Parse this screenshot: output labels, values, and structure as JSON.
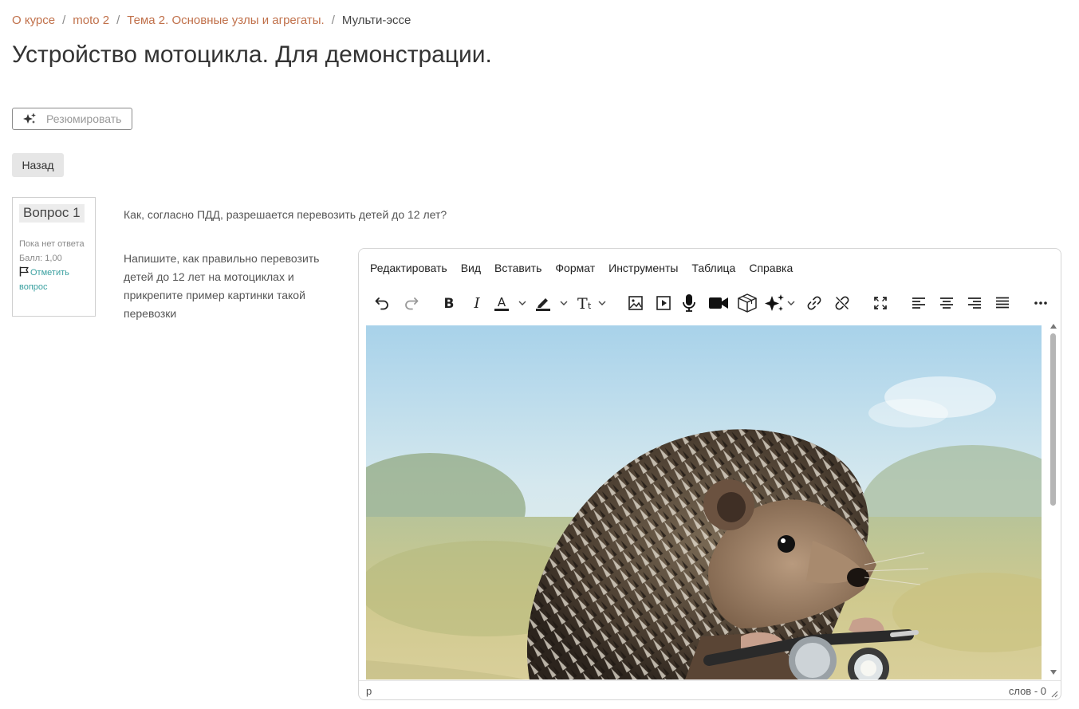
{
  "breadcrumb": {
    "items": [
      "О курсе",
      "moto 2",
      "Тема 2. Основные узлы и агрегаты."
    ],
    "current": "Мульти-эссе",
    "separator": "/"
  },
  "page_title": "Устройство мотоцикла. Для демонстрации.",
  "summarize_button": {
    "label": "Резюмировать",
    "icon": "sparkles-icon"
  },
  "back_button": {
    "label": "Назад"
  },
  "question_info": {
    "title": "Вопрос 1",
    "status": "Пока нет ответа",
    "score": "Балл: 1,00",
    "flag_label": "Отметить вопрос"
  },
  "question_text": "Как, согласно ПДД, разрешается перевозить детей до 12 лет?",
  "prompt_text": "Напишите, как правильно перевозить детей до 12 лет на мотоциклах и прикрепите пример картинки такой перевозки",
  "editor": {
    "menus": [
      "Редактировать",
      "Вид",
      "Вставить",
      "Формат",
      "Инструменты",
      "Таблица",
      "Справка"
    ],
    "toolbar": [
      "undo-icon",
      "redo-icon",
      "bold-icon",
      "italic-icon",
      "text-color-icon",
      "highlight-color-icon",
      "font-size-icon",
      "image-icon",
      "media-icon",
      "record-audio-icon",
      "record-video-icon",
      "h5p-icon",
      "ai-icon",
      "link-icon",
      "unlink-icon",
      "fullscreen-icon",
      "align-left-icon",
      "align-center-icon",
      "align-right-icon",
      "justify-icon",
      "more-icon"
    ],
    "content_image": "hedgehog-on-motorcycle",
    "status_path": "p",
    "word_count": "слов - 0"
  },
  "colors": {
    "link": "#c0704a",
    "flag_link": "#3aa0a0",
    "text": "#333333",
    "button_bg": "#e6e6e6"
  }
}
